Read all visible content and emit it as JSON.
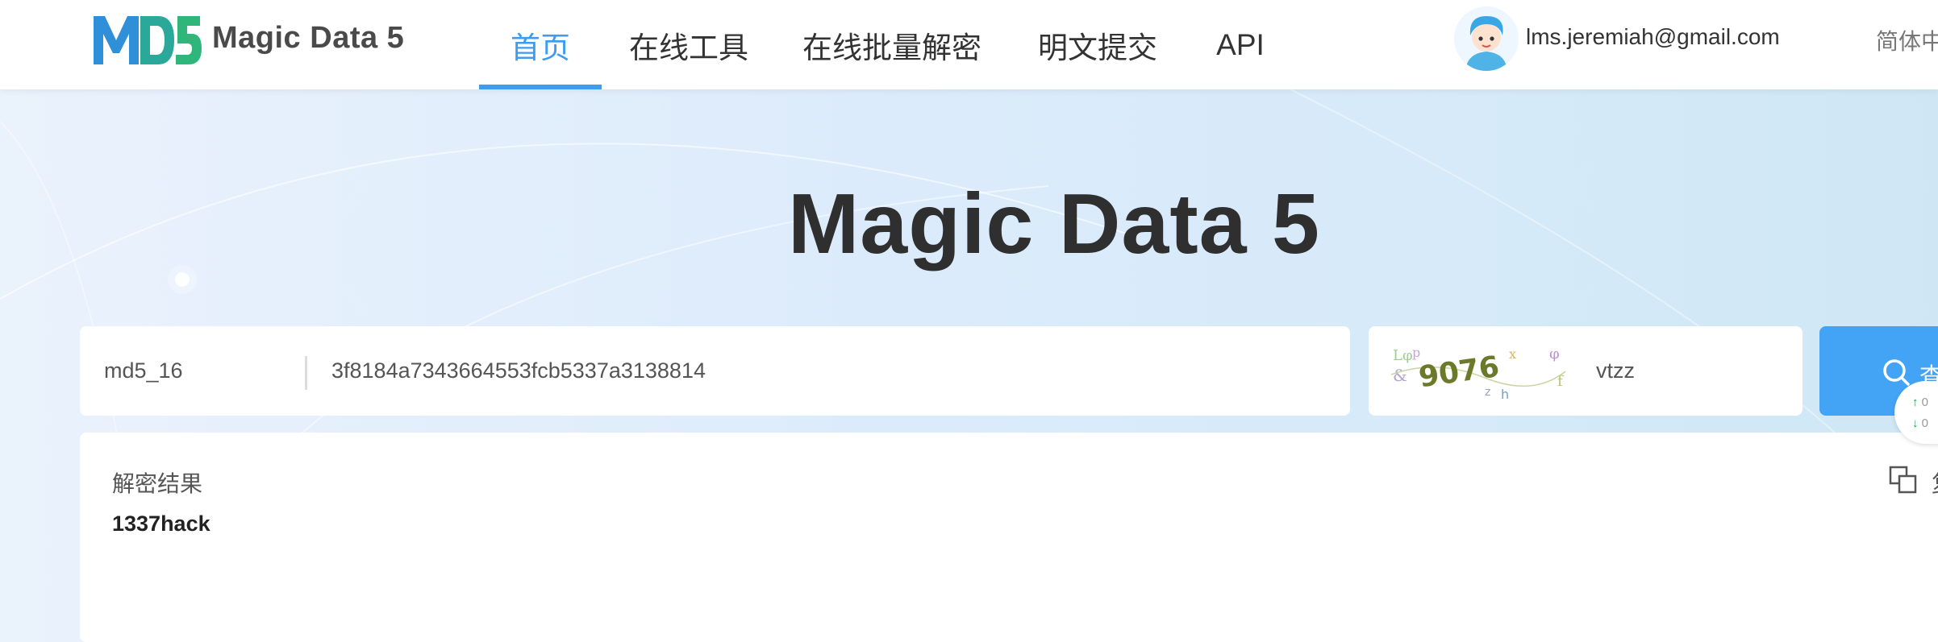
{
  "brand": {
    "logo_text": "MD5",
    "name": "Magic Data 5"
  },
  "nav": {
    "items": [
      {
        "label": "首页",
        "active": true
      },
      {
        "label": "在线工具",
        "active": false
      },
      {
        "label": "在线批量解密",
        "active": false
      },
      {
        "label": "明文提交",
        "active": false
      },
      {
        "label": "API",
        "active": false
      }
    ]
  },
  "user": {
    "email": "lms.jeremiah@gmail.com",
    "avatar_icon": "cartoon-avatar"
  },
  "language": {
    "label": "简体中"
  },
  "hero": {
    "title": "Magic Data 5"
  },
  "search": {
    "type": "md5_16",
    "hash_value": "3f8184a7343664553fcb5337a3138814",
    "captcha_value": "vtzz",
    "captcha_image_text": "9076",
    "query_label": "查",
    "query_icon": "search-icon"
  },
  "speed": {
    "up": "0",
    "down": "0"
  },
  "result": {
    "label": "解密结果",
    "value": "1337hack",
    "copy_icon": "copy-icon",
    "copy_label_cut": "复"
  },
  "colors": {
    "accent": "#3d9cf0",
    "button": "#43a3f5",
    "background": "#dcebfb"
  }
}
